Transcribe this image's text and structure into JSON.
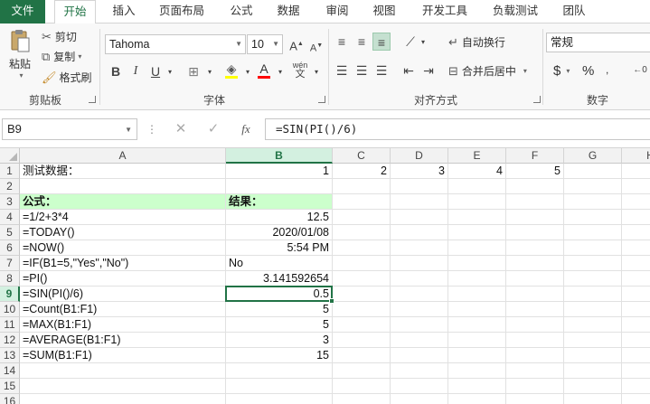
{
  "tabs": [
    "文件",
    "开始",
    "插入",
    "页面布局",
    "公式",
    "数据",
    "审阅",
    "视图",
    "开发工具",
    "负载测试",
    "团队"
  ],
  "active_tab": "开始",
  "ribbon": {
    "clipboard": {
      "paste": "粘贴",
      "cut": "剪切",
      "copy": "复制",
      "format_painter": "格式刷",
      "label": "剪贴板"
    },
    "font": {
      "font_name": "Tahoma",
      "font_size": "10",
      "bold": "B",
      "italic": "I",
      "underline": "U",
      "phonetic": "wén",
      "label": "字体",
      "fill_color": "#ffff00",
      "font_color": "#ff0000"
    },
    "alignment": {
      "wrap_text": "自动换行",
      "merge_center": "合并后居中",
      "label": "对齐方式"
    },
    "number": {
      "format": "常规",
      "currency": "$",
      "percent": "%",
      "label": "数字"
    }
  },
  "formula_bar": {
    "name_box": "B9",
    "cancel": "✕",
    "enter": "✓",
    "fx": "fx",
    "formula": "=SIN(PI()/6)"
  },
  "grid": {
    "columns": [
      "A",
      "B",
      "C",
      "D",
      "E",
      "F",
      "G",
      "H"
    ],
    "selected_column": "B",
    "selected_row": "9",
    "rows": [
      {
        "num": "1",
        "A": "测试数据：",
        "B": "1",
        "C": "2",
        "D": "3",
        "E": "4",
        "F": "5"
      },
      {
        "num": "2",
        "A": "",
        "B": ""
      },
      {
        "num": "3",
        "A": "公式：",
        "B": "结果："
      },
      {
        "num": "4",
        "A": "=1/2+3*4",
        "B": "12.5"
      },
      {
        "num": "5",
        "A": "=TODAY()",
        "B": "2020/01/08"
      },
      {
        "num": "6",
        "A": "=NOW()",
        "B": "5:54 PM"
      },
      {
        "num": "7",
        "A": "=IF(B1=5,\"Yes\",\"No\")",
        "B": "No"
      },
      {
        "num": "8",
        "A": "=PI()",
        "B": "3.141592654"
      },
      {
        "num": "9",
        "A": "=SIN(PI()/6)",
        "B": "0.5"
      },
      {
        "num": "10",
        "A": "=Count(B1:F1)",
        "B": "5"
      },
      {
        "num": "11",
        "A": "=MAX(B1:F1)",
        "B": "5"
      },
      {
        "num": "12",
        "A": "=AVERAGE(B1:F1)",
        "B": "3"
      },
      {
        "num": "13",
        "A": "=SUM(B1:F1)",
        "B": "15"
      },
      {
        "num": "14"
      },
      {
        "num": "15"
      },
      {
        "num": "16"
      }
    ]
  },
  "colors": {
    "accent": "#217346",
    "header_fill": "#ccffcc"
  }
}
